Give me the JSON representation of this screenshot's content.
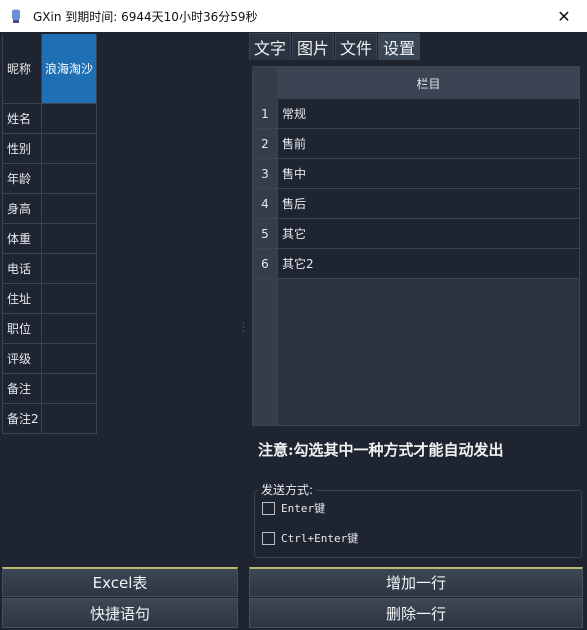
{
  "window": {
    "title": "GXin 到期时间: 6944天10小时36分59秒",
    "close_glyph": "✕"
  },
  "profile": {
    "fields": [
      {
        "label": "昵称",
        "value": "浪海淘沙"
      },
      {
        "label": "姓名",
        "value": ""
      },
      {
        "label": "性别",
        "value": ""
      },
      {
        "label": "年龄",
        "value": ""
      },
      {
        "label": "身高",
        "value": ""
      },
      {
        "label": "体重",
        "value": ""
      },
      {
        "label": "电话",
        "value": ""
      },
      {
        "label": "住址",
        "value": ""
      },
      {
        "label": "职位",
        "value": ""
      },
      {
        "label": "评级",
        "value": ""
      },
      {
        "label": "备注",
        "value": ""
      },
      {
        "label": "备注2",
        "value": ""
      }
    ]
  },
  "tabs": [
    "文字",
    "图片",
    "文件",
    "设置"
  ],
  "active_tab": "设置",
  "category_table": {
    "header": "栏目",
    "rows": [
      {
        "num": "1",
        "name": "常规"
      },
      {
        "num": "2",
        "name": "售前"
      },
      {
        "num": "3",
        "name": "售中"
      },
      {
        "num": "4",
        "name": "售后"
      },
      {
        "num": "5",
        "name": "其它"
      },
      {
        "num": "6",
        "name": "其它2"
      }
    ]
  },
  "notice": "注意:勾选其中一种方式才能自动发出",
  "send_mode": {
    "title": "发送方式:",
    "options": [
      {
        "label": "Enter键",
        "checked": false
      },
      {
        "label": "Ctrl+Enter键",
        "checked": false
      }
    ]
  },
  "buttons": {
    "excel": "Excel表",
    "quick_phrases": "快捷语句",
    "add_row": "增加一行",
    "delete_row": "删除一行"
  },
  "colors": {
    "background": "#1e2530",
    "selected_cell": "#1f6fb5",
    "grid": "#3a4453"
  }
}
